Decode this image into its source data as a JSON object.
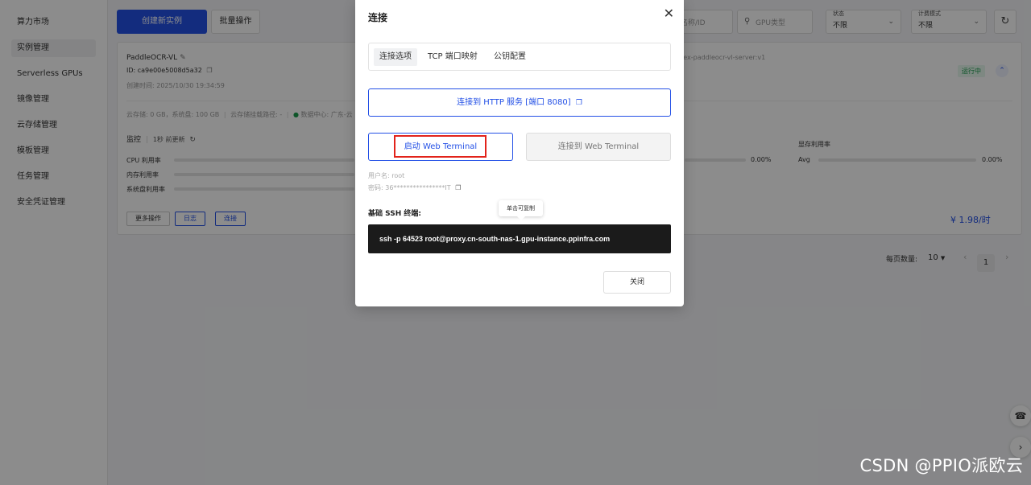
{
  "sidebar": {
    "items": [
      {
        "label": "算力市场"
      },
      {
        "label": "实例管理"
      },
      {
        "label": "Serverless GPUs"
      },
      {
        "label": "镜像管理"
      },
      {
        "label": "云存储管理"
      },
      {
        "label": "模板管理"
      },
      {
        "label": "任务管理"
      },
      {
        "label": "安全凭证管理"
      }
    ]
  },
  "toolbar": {
    "create_label": "创建新实例",
    "batch_label": "批量操作"
  },
  "filters": {
    "name_placeholder": "名称/ID",
    "gpu_placeholder": "GPU类型",
    "status_label": "状态",
    "status_value": "不限",
    "billing_label": "计费模式",
    "billing_value": "不限"
  },
  "instance": {
    "name": "PaddleOCR-VL",
    "id": "ID: ca9e00e5008d5a32",
    "created": "创建时间: 2025/10/30 19:34:59",
    "image": "lex-paddleocr-vl-server:v1",
    "status": "运行中",
    "storage": "云存储: 0 GB，系统盘: 100 GB",
    "mount": "云存储挂载路径: -",
    "datacenter": "数据中心: 广东-云",
    "monitor_label": "监控",
    "monitor_update": "1秒 前更新",
    "metrics": [
      "CPU 利用率",
      "内存利用率",
      "系统盘利用率"
    ],
    "cpu_pct": "0.00%",
    "gpu_mem_label": "显存利用率",
    "avg_label": "Avg",
    "avg_pct": "0.00%",
    "more_label": "更多操作",
    "log_label": "日志",
    "connect_label": "连接",
    "price": "¥ 1.98/时"
  },
  "pagination": {
    "per_page_label": "每页数量:",
    "per_page_value": "10",
    "current_page": "1"
  },
  "modal": {
    "title": "连接",
    "tabs": [
      "连接选项",
      "TCP 端口映射",
      "公钥配置"
    ],
    "http_button": "连接到 HTTP 服务 [端口 8080]",
    "start_terminal": "启动 Web Terminal",
    "connect_terminal": "连接到 Web Terminal",
    "username": "用户名: root",
    "password": "密码: 36****************IT",
    "ssh_title": "基础 SSH 终端:",
    "tooltip": "单击可复制",
    "ssh_command": "ssh -p 64523 root@proxy.cn-south-nas-1.gpu-instance.ppinfra.com",
    "close_button": "关闭"
  },
  "watermark": "CSDN @PPIO派欧云",
  "colors": {
    "primary": "#2350e6",
    "highlight": "#e2231a",
    "running": "#1a9b4b"
  }
}
